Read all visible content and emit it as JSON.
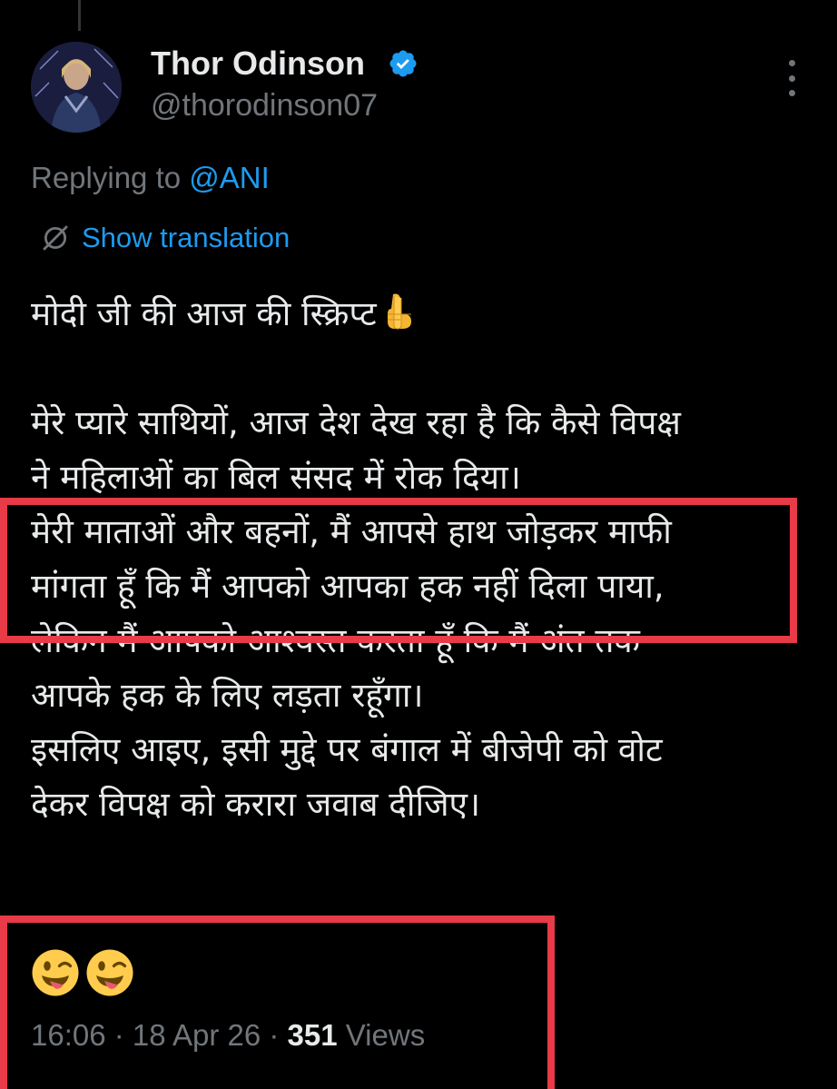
{
  "tweet": {
    "author": {
      "name": "Thor Odinson",
      "handle": "@thorodinson07",
      "verified": true,
      "verified_color": "#1d9bf0"
    },
    "reply": {
      "prefix": "Replying to ",
      "mention": "@ANI"
    },
    "translation_link": "Show translation",
    "lines": [
      "मोदी जी की आज की स्क्रिप्ट",
      "",
      "मेरे प्यारे साथियों, आज देश देख रहा है कि कैसे विपक्ष",
      "ने महिलाओं का बिल संसद में रोक दिया।",
      "मेरी माताओं और बहनों, मैं आपसे हाथ जोड़कर माफी",
      "मांगता हूँ कि मैं आपको आपका हक नहीं दिला पाया,",
      "लेकिन मैं आपको आश्वस्त करता हूँ कि मैं अंत तक",
      "आपके हक के लिए लड़ता रहूँगा।",
      "इसलिए आइए, इसी मुद्दे पर बंगाल में बीजेपी को वोट",
      "देकर विपक्ष को करारा जवाब दीजिए।"
    ],
    "time": "16:06",
    "separator": " · ",
    "date": "18 Apr 26",
    "views_count": "351",
    "views_label": " Views"
  },
  "icons": {
    "verified": "verified-badge-icon",
    "more": "more-dots-icon",
    "translate": "translate-icon",
    "point_down": "backhand-index-pointing-down-emoji",
    "tongue": "winking-face-with-tongue-emoji"
  },
  "colors": {
    "background": "#000000",
    "text": "#e7e9ea",
    "secondary": "#71767b",
    "link": "#1d9bf0",
    "highlight": "#e83a47"
  }
}
